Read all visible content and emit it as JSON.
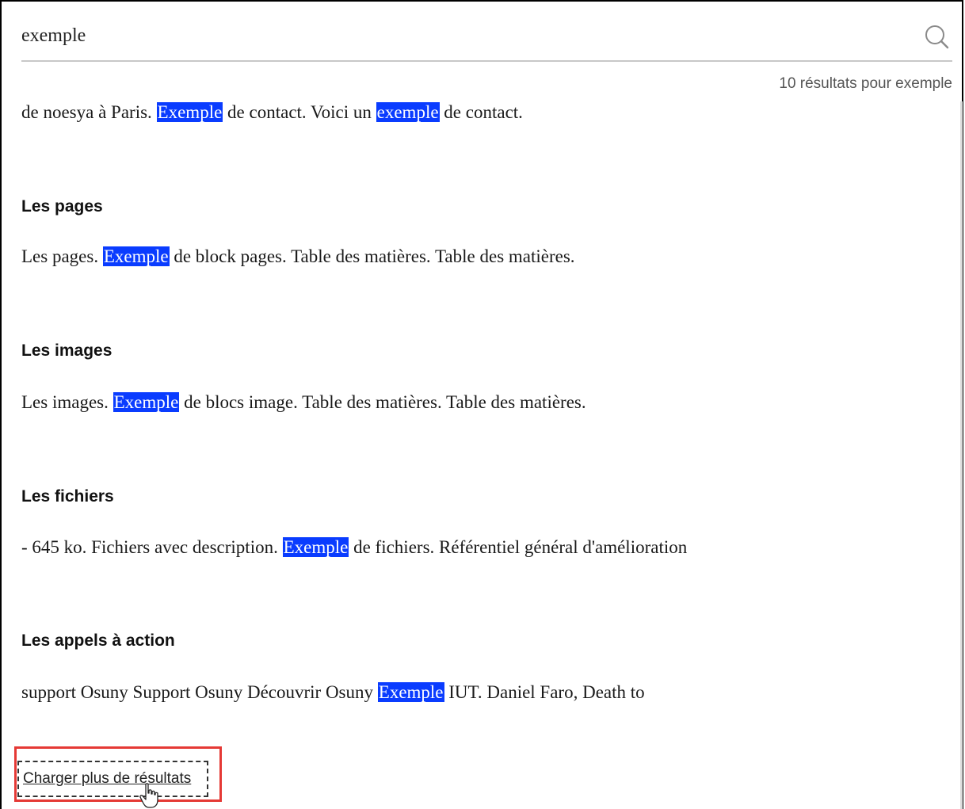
{
  "search": {
    "value": "exemple",
    "icon": "search-icon"
  },
  "results_count": "10 résultats pour exemple",
  "results": [
    {
      "title": "",
      "excerpt": [
        {
          "text": "de noesya à Paris. ",
          "hl": false
        },
        {
          "text": "Exemple",
          "hl": true
        },
        {
          "text": " de contact. Voici un ",
          "hl": false
        },
        {
          "text": "exemple",
          "hl": true
        },
        {
          "text": " de contact.",
          "hl": false
        }
      ]
    },
    {
      "title": "Les pages",
      "excerpt": [
        {
          "text": "Les pages. ",
          "hl": false
        },
        {
          "text": "Exemple",
          "hl": true
        },
        {
          "text": " de block pages. Table des matières. Table des matières.",
          "hl": false
        }
      ]
    },
    {
      "title": "Les images",
      "excerpt": [
        {
          "text": "Les images. ",
          "hl": false
        },
        {
          "text": "Exemple",
          "hl": true
        },
        {
          "text": " de blocs image. Table des matières. Table des matières.",
          "hl": false
        }
      ]
    },
    {
      "title": "Les fichiers",
      "excerpt": [
        {
          "text": "- 645 ko. Fichiers avec description. ",
          "hl": false
        },
        {
          "text": "Exemple",
          "hl": true
        },
        {
          "text": " de fichiers. Référentiel général d'amélioration",
          "hl": false
        }
      ]
    },
    {
      "title": "Les appels à action",
      "excerpt": [
        {
          "text": "support Osuny Support Osuny Découvrir Osuny ",
          "hl": false
        },
        {
          "text": "Exemple",
          "hl": true
        },
        {
          "text": " IUT. Daniel Faro, Death to",
          "hl": false
        }
      ]
    }
  ],
  "load_more_label": "Charger plus de résultats",
  "colors": {
    "highlight": "#0a3cff",
    "focus_outline": "#e53935"
  }
}
